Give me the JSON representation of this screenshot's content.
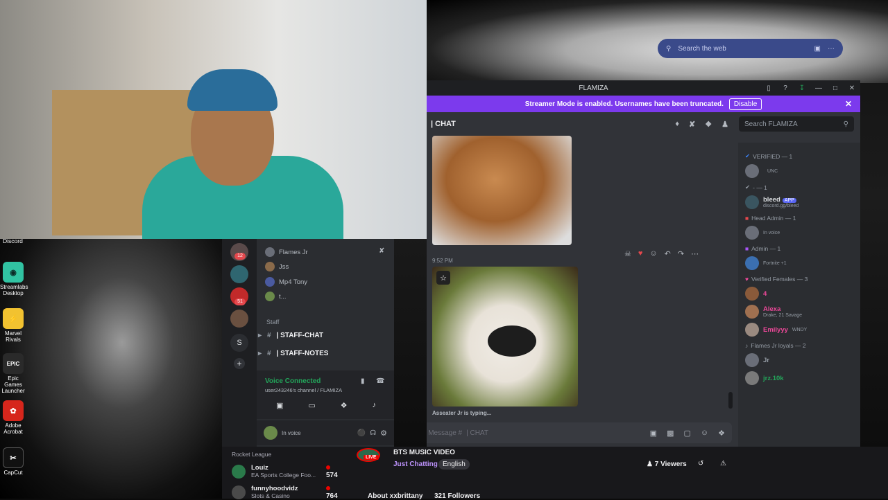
{
  "desktop": {
    "left_label": "Discord",
    "icons": [
      {
        "label": "Streamlabs Desktop",
        "icon": "streamlabs-icon",
        "color": "#31c3a2"
      },
      {
        "label": "Marvel Rivals",
        "icon": "marvel-rivals-icon",
        "color": "#f2c230"
      },
      {
        "label": "Epic Games Launcher",
        "icon": "epic-games-icon",
        "color": "#2a2a2a"
      },
      {
        "label": "Adobe Acrobat",
        "icon": "acrobat-icon",
        "color": "#d6261c"
      },
      {
        "label": "CapCut",
        "icon": "capcut-icon",
        "color": "#111111"
      }
    ]
  },
  "web_search": {
    "placeholder": "Search the web"
  },
  "discord": {
    "window_title": "FLAMIZA",
    "streamer_notice": "Streamer Mode is enabled. Usernames have been truncated.",
    "disable_label": "Disable",
    "channel_name": "| CHAT",
    "search_placeholder": "Search FLAMIZA",
    "message_time": "9:52 PM",
    "typing": "Asseater Jr is typing...",
    "compose_placeholder": "Message #",
    "compose_channel": "| CHAT",
    "member_groups": [
      {
        "title": "VERIFIED — 1",
        "members": [
          {
            "name": "",
            "sub": "UNC"
          }
        ]
      },
      {
        "title": "- — 1",
        "members": [
          {
            "name": "bleed",
            "tag": "APP",
            "sub": "discord.gg/bleed"
          }
        ]
      },
      {
        "title": "Head Admin — 1",
        "members": [
          {
            "name": "",
            "sub": "In voice"
          }
        ]
      },
      {
        "title": "Admin — 1",
        "members": [
          {
            "name": "",
            "sub": "Fortnite +1"
          }
        ]
      },
      {
        "title": "Verified Females — 3",
        "members": [
          {
            "name": "4",
            "sub": ""
          },
          {
            "name": "Alexa",
            "sub": "Drake, 21 Savage"
          },
          {
            "name": "Emilyyy",
            "sub": "WNDY"
          }
        ]
      },
      {
        "title": "Flames Jr loyals — 2",
        "members": [
          {
            "name": "Jr",
            "sub": ""
          },
          {
            "name": "jrz.10k",
            "sub": ""
          }
        ]
      }
    ],
    "sidebar": {
      "voice_users": [
        "Flames Jr",
        "Jss",
        "Mp4 Tony",
        "t..."
      ],
      "category": "Staff",
      "channels": [
        "| STAFF-CHAT",
        "| STAFF-NOTES"
      ],
      "guild_badges": [
        "12",
        "51"
      ],
      "guild_letter": "S"
    },
    "voice": {
      "status": "Voice Connected",
      "channel": "user243246's channel / FLAMIZA"
    },
    "user": {
      "status": "In voice"
    }
  },
  "twitch": {
    "rows": [
      {
        "name": "Rocket League",
        "game": "",
        "viewers": ""
      },
      {
        "name": "Louiz",
        "game": "EA Sports College Foo...",
        "viewers": "574"
      },
      {
        "name": "funnyhoodvidz",
        "game": "Slots & Casino",
        "viewers": "764"
      }
    ],
    "stream_title": "BTS MUSIC VIDEO",
    "live_label": "LIVE",
    "category": "Just Chatting",
    "language": "English",
    "viewers": "7 Viewers",
    "about": "About xxbrittany",
    "followers": "321 Followers"
  },
  "colors": {
    "accent": "#7c3aed",
    "discord_bg": "#313338",
    "online": "#23a55a",
    "twitch_live": "#eb0400"
  }
}
